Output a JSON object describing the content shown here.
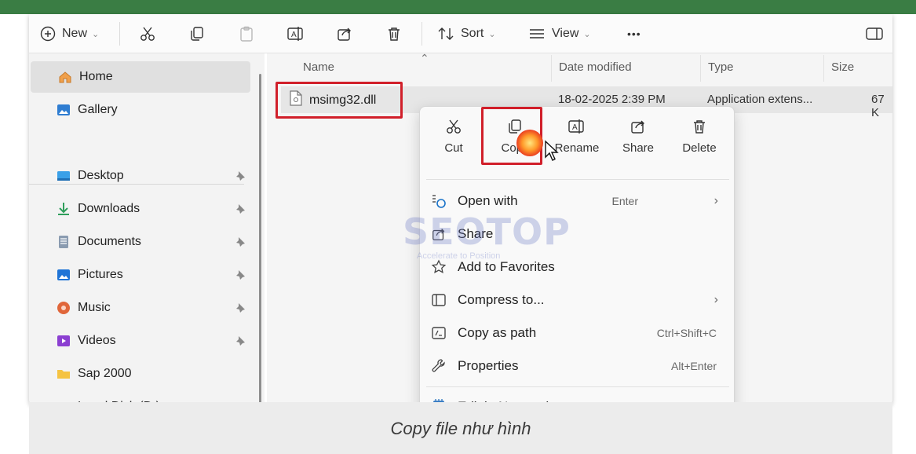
{
  "toolbar": {
    "new_label": "New",
    "sort_label": "Sort",
    "view_label": "View",
    "more_label": "•••"
  },
  "sidebar": {
    "items": [
      {
        "label": "Home",
        "icon": "home-icon"
      },
      {
        "label": "Gallery",
        "icon": "gallery-icon"
      },
      {
        "label": "Desktop",
        "icon": "desktop-icon"
      },
      {
        "label": "Downloads",
        "icon": "download-icon"
      },
      {
        "label": "Documents",
        "icon": "documents-icon"
      },
      {
        "label": "Pictures",
        "icon": "pictures-icon"
      },
      {
        "label": "Music",
        "icon": "music-icon"
      },
      {
        "label": "Videos",
        "icon": "videos-icon"
      },
      {
        "label": "Sap 2000",
        "icon": "folder-icon"
      },
      {
        "label": "Local Disk (D:)",
        "icon": "drive-icon"
      }
    ]
  },
  "columns": {
    "name": "Name",
    "date_modified": "Date modified",
    "type": "Type",
    "size": "Size"
  },
  "file": {
    "name": "msimg32.dll",
    "date_modified": "18-02-2025 2:39 PM",
    "type": "Application extens...",
    "size": "67 K"
  },
  "context_menu": {
    "quick_actions": {
      "cut": "Cut",
      "copy": "Copy",
      "rename": "Rename",
      "share": "Share",
      "delete": "Delete"
    },
    "items": [
      {
        "label": "Open with",
        "shortcut": "Enter"
      },
      {
        "label": "Share",
        "shortcut": ""
      },
      {
        "label": "Add to Favorites",
        "shortcut": ""
      },
      {
        "label": "Compress to...",
        "shortcut": ""
      },
      {
        "label": "Copy as path",
        "shortcut": "Ctrl+Shift+C"
      },
      {
        "label": "Properties",
        "shortcut": "Alt+Enter"
      },
      {
        "label": "Edit in Notepad",
        "shortcut": ""
      }
    ]
  },
  "watermark": {
    "text": "SEOTOP",
    "tagline": "Accelerate to Position"
  },
  "caption": "Copy file như hình",
  "colors": {
    "top_bar": "#3a7d44",
    "highlight_box": "#d11f2a",
    "accent": "#0067c0"
  }
}
